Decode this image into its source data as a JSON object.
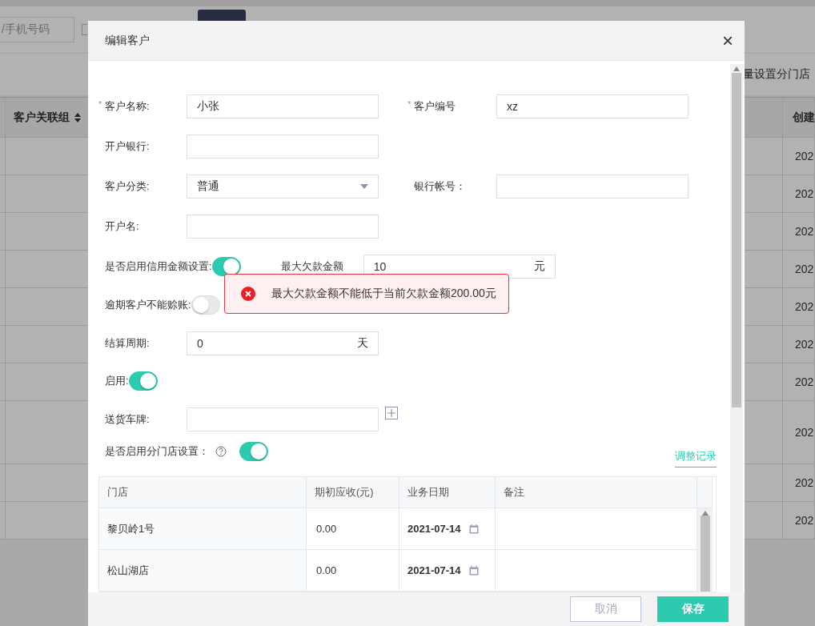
{
  "background": {
    "search_placeholder": "/手机号码",
    "checkbox": {
      "checked": false
    },
    "toolbar_link": "量设置分门店",
    "table": {
      "columns": [
        {
          "label": "客户关联组",
          "sortable": true
        },
        {
          "label": "创建"
        }
      ],
      "rows": [
        {
          "created": "202"
        },
        {
          "created": "202"
        },
        {
          "created": "202"
        },
        {
          "created": "202"
        },
        {
          "created": "202"
        },
        {
          "created": "202"
        },
        {
          "created": "202"
        },
        {
          "created": "202"
        },
        {
          "created": "202"
        },
        {
          "created": "202"
        }
      ]
    }
  },
  "dialog": {
    "title": "编辑客户",
    "close": "×",
    "rows": [
      [
        {
          "kind": "text",
          "label": "客户名称:",
          "required_mark": "*",
          "value": "小张"
        },
        {
          "kind": "text",
          "label": "客户编号",
          "required_mark": "*",
          "value": "xz"
        }
      ],
      [
        {
          "kind": "text",
          "label": "开户银行:"
        }
      ],
      [
        {
          "kind": "select",
          "label": "客户分类:",
          "value": "普通"
        },
        {
          "kind": "text",
          "label": "银行帐号："
        }
      ],
      [
        {
          "kind": "text",
          "label": "开户名:"
        }
      ],
      [
        {
          "kind": "toggle",
          "label": "是否启用信用金额设置:",
          "on": true
        },
        {
          "kind": "unit",
          "label": "最大欠款金额",
          "value": "10",
          "unit": "元"
        }
      ],
      [
        {
          "kind": "toggle",
          "label": "逾期客户不能赊账:",
          "on": false
        }
      ],
      [
        {
          "kind": "unit",
          "label": "结算周期:",
          "value": "0",
          "unit": "天"
        }
      ],
      [
        {
          "kind": "toggle",
          "label": "启用:",
          "on": true
        }
      ],
      [
        {
          "kind": "plate",
          "label": "送货车牌:"
        }
      ]
    ],
    "toast": {
      "message": "最大欠款金额不能低于当前欠款金额200.00元"
    },
    "branch": {
      "label": "是否启用分门店设置：",
      "on": true,
      "link": "调整记录",
      "columns": [
        "门店",
        "期初应收(元)",
        "业务日期",
        "备注"
      ],
      "rows": [
        {
          "store": "黎贝岭1号",
          "receivable": "0.00",
          "date": "2021-07-14"
        },
        {
          "store": "松山湖店",
          "receivable": "0.00",
          "date": "2021-07-14"
        }
      ]
    },
    "buttons": [
      {
        "kind": "cancel",
        "label": "取消"
      },
      {
        "kind": "primary",
        "label": "保存"
      }
    ]
  }
}
